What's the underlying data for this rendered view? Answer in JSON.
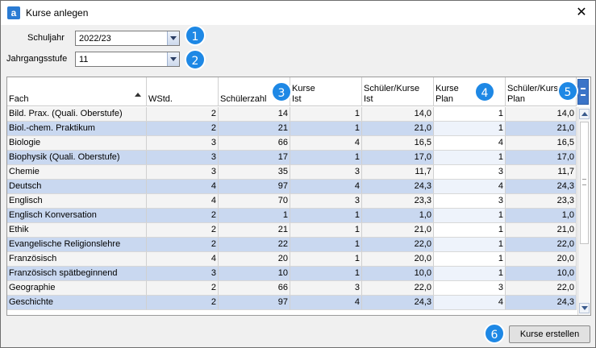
{
  "window": {
    "title": "Kurse anlegen",
    "close_label": "✕",
    "app_icon_letter": "a"
  },
  "form": {
    "schuljahr_label": "Schuljahr",
    "schuljahr_value": "2022/23",
    "jahrgangsstufe_label": "Jahrgangsstufe",
    "jahrgangsstufe_value": "11"
  },
  "badges": [
    "1",
    "2",
    "3",
    "4",
    "5",
    "6"
  ],
  "table": {
    "headers": [
      "Fach",
      "WStd.",
      "Schülerzahl",
      "Kurse\nIst",
      "Schüler/Kurse\nIst",
      "Kurse\nPlan",
      "Schüler/Kurs\nPlan"
    ],
    "rows": [
      [
        "Bild. Prax. (Quali. Oberstufe)",
        "2",
        "14",
        "1",
        "14,0",
        "1",
        "14,0"
      ],
      [
        "Biol.-chem. Praktikum",
        "2",
        "21",
        "1",
        "21,0",
        "1",
        "21,0"
      ],
      [
        "Biologie",
        "3",
        "66",
        "4",
        "16,5",
        "4",
        "16,5"
      ],
      [
        "Biophysik (Quali. Oberstufe)",
        "3",
        "17",
        "1",
        "17,0",
        "1",
        "17,0"
      ],
      [
        "Chemie",
        "3",
        "35",
        "3",
        "11,7",
        "3",
        "11,7"
      ],
      [
        "Deutsch",
        "4",
        "97",
        "4",
        "24,3",
        "4",
        "24,3"
      ],
      [
        "Englisch",
        "4",
        "70",
        "3",
        "23,3",
        "3",
        "23,3"
      ],
      [
        "Englisch Konversation",
        "2",
        "1",
        "1",
        "1,0",
        "1",
        "1,0"
      ],
      [
        "Ethik",
        "2",
        "21",
        "1",
        "21,0",
        "1",
        "21,0"
      ],
      [
        "Evangelische Religionslehre",
        "2",
        "22",
        "1",
        "22,0",
        "1",
        "22,0"
      ],
      [
        "Französisch",
        "4",
        "20",
        "1",
        "20,0",
        "1",
        "20,0"
      ],
      [
        "Französisch spätbeginnend",
        "3",
        "10",
        "1",
        "10,0",
        "1",
        "10,0"
      ],
      [
        "Geographie",
        "2",
        "66",
        "3",
        "22,0",
        "3",
        "22,0"
      ],
      [
        "Geschichte",
        "2",
        "97",
        "4",
        "24,3",
        "4",
        "24,3"
      ]
    ]
  },
  "footer": {
    "create_button": "Kurse erstellen"
  },
  "colors": {
    "accent": "#1e88e5",
    "row_alt": "#c9d8f0"
  }
}
